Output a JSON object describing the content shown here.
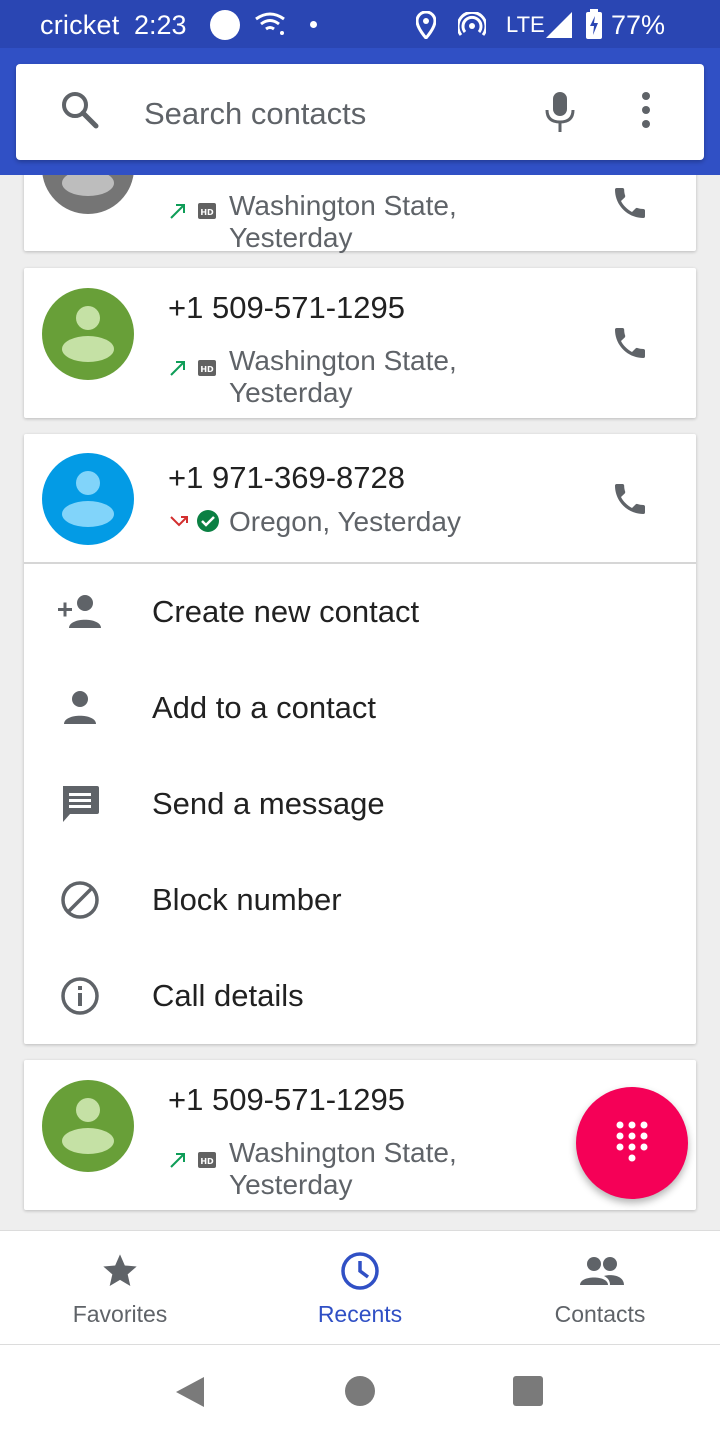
{
  "status_bar": {
    "carrier": "cricket",
    "time": "2:23",
    "network": "LTE",
    "battery": "77%",
    "icons": [
      "notification-dot-icon",
      "wifi-question-icon",
      "location-icon",
      "hotspot-icon",
      "signal-icon",
      "battery-charging-icon"
    ]
  },
  "search": {
    "placeholder": "Search contacts",
    "icons": [
      "search-icon",
      "mic-icon",
      "more-vert-icon"
    ]
  },
  "calls": [
    {
      "number": "",
      "location": "Washington State,",
      "when": "Yesterday",
      "direction": "outgoing",
      "hd": true,
      "avatar_color": "#757575"
    },
    {
      "number": "+1 509-571-1295",
      "location": "Washington State,",
      "when": "Yesterday",
      "direction": "outgoing",
      "hd": true,
      "avatar_color": "#689f38"
    },
    {
      "number": "+1 971-369-8728",
      "location_line": "Oregon, Yesterday",
      "direction": "missed",
      "verified": true,
      "avatar_color": "#039be5",
      "expanded": true
    },
    {
      "number": "+1 509-571-1295",
      "location": "Washington State,",
      "when": "Yesterday",
      "direction": "outgoing",
      "hd": true,
      "avatar_color": "#689f38"
    }
  ],
  "actions": [
    {
      "label": "Create new contact",
      "icon": "person-add-icon"
    },
    {
      "label": "Add to a contact",
      "icon": "person-icon"
    },
    {
      "label": "Send a message",
      "icon": "message-icon"
    },
    {
      "label": "Block number",
      "icon": "block-icon"
    },
    {
      "label": "Call details",
      "icon": "info-icon"
    }
  ],
  "fab": {
    "icon": "dialpad-icon",
    "color": "#f50057"
  },
  "bottom_nav": {
    "tabs": [
      {
        "label": "Favorites",
        "icon": "star-icon",
        "active": false
      },
      {
        "label": "Recents",
        "icon": "clock-icon",
        "active": true
      },
      {
        "label": "Contacts",
        "icon": "people-icon",
        "active": false
      }
    ]
  },
  "colors": {
    "primary": "#3050c5",
    "status_bar": "#2a46b3",
    "accent": "#f50057",
    "outgoing_arrow": "#0f9d58",
    "missed_arrow": "#d32f2f"
  }
}
